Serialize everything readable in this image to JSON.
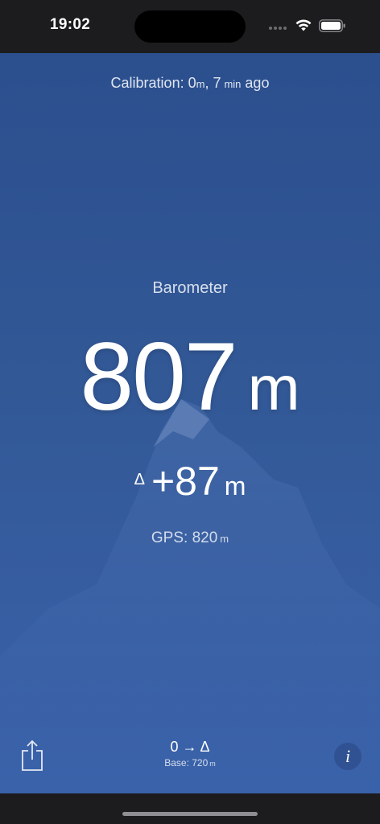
{
  "status_bar": {
    "time": "19:02"
  },
  "calibration": {
    "prefix": "Calibration: ",
    "value": "0",
    "value_unit": "m",
    "separator": ", ",
    "age_value": "7",
    "age_unit": "min",
    "suffix": " ago"
  },
  "reading": {
    "source_label": "Barometer",
    "altitude_value": "807",
    "altitude_unit": "m",
    "delta_symbol": "Δ",
    "delta_value": "+87",
    "delta_unit": "m",
    "gps_prefix": "GPS: ",
    "gps_value": "820",
    "gps_unit": "m"
  },
  "bottom_bar": {
    "mode_label": "0 → Δ",
    "base_prefix": "Base: ",
    "base_value": "720",
    "base_unit": "m",
    "info_label": "i"
  },
  "icons": {
    "share": "share-icon",
    "info": "info-icon",
    "wifi": "wifi-icon",
    "battery": "battery-icon"
  },
  "colors": {
    "background_top": "#2c4f8e",
    "background_bottom": "#3a62aa",
    "status_bar": "#1c1c1e"
  }
}
